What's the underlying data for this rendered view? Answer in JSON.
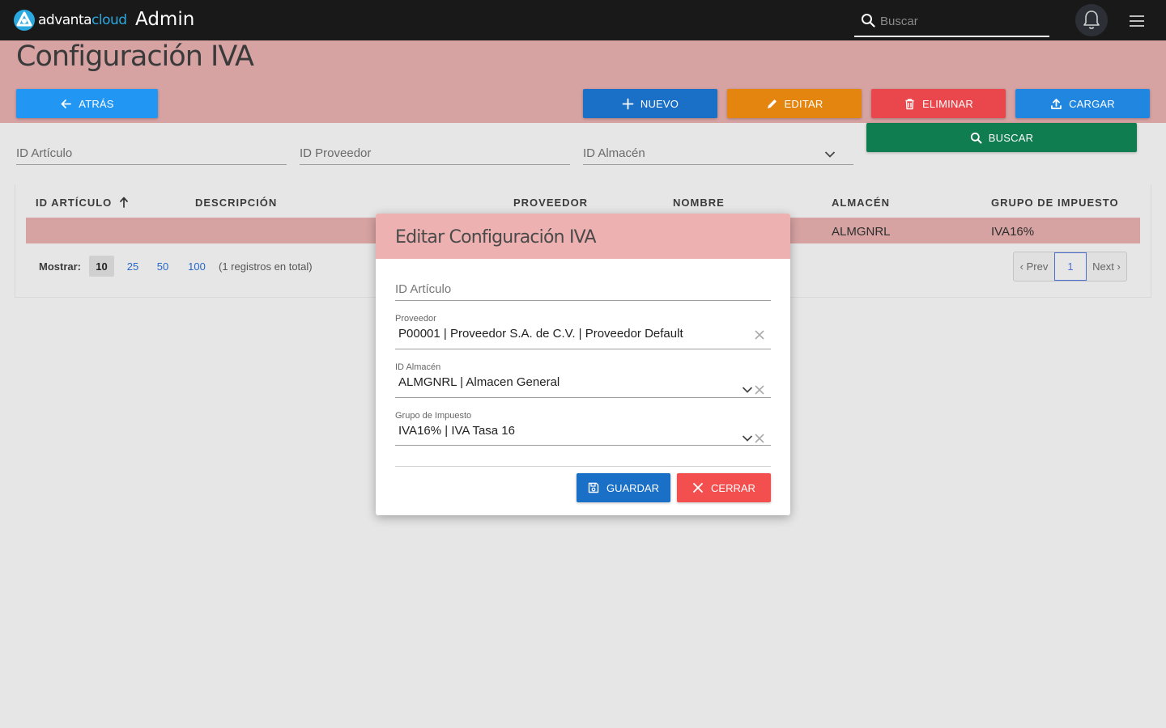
{
  "app": {
    "logo_part1": "advanta",
    "logo_part2": "cloud",
    "title": "Admin"
  },
  "topbar": {
    "search_placeholder": "Buscar",
    "icons": [
      "search-icon",
      "bell-icon",
      "menu-icon"
    ]
  },
  "page": {
    "title": "Configuración IVA"
  },
  "toolbar": {
    "back_label": "ATRÁS",
    "new_label": "NUEVO",
    "edit_label": "EDITAR",
    "delete_label": "ELIMINAR",
    "load_label": "CARGAR",
    "search_label": "BUSCAR"
  },
  "filters": {
    "articulo": "ID Artículo",
    "proveedor": "ID Proveedor",
    "almacen": "ID Almacén"
  },
  "table": {
    "columns": [
      "ID ARTÍCULO",
      "DESCRIPCIÓN",
      "PROVEEDOR",
      "NOMBRE",
      "ALMACÉN",
      "GRUPO DE IMPUESTO"
    ],
    "rows": [
      {
        "almacen": "ALMGNRL",
        "grupo": "IVA16%"
      }
    ]
  },
  "pagination": {
    "show_label": "Mostrar:",
    "sizes": [
      "10",
      "25",
      "50",
      "100"
    ],
    "selected_size": "10",
    "total_text": "(1 registros en total)",
    "prev": "‹ Prev",
    "current": "1",
    "next": "Next ›"
  },
  "modal": {
    "title": "Editar Configuración IVA",
    "articulo_placeholder": "ID Artículo",
    "proveedor_label": "Proveedor",
    "proveedor_value": "P00001 | Proveedor S.A. de C.V. | Proveedor Default",
    "almacen_label": "ID Almacén",
    "almacen_value": "ALMGNRL | Almacen General",
    "grupo_label": "Grupo de Impuesto",
    "grupo_value": "IVA16% | IVA Tasa 16",
    "save_label": "GUARDAR",
    "close_label": "CERRAR"
  },
  "colors": {
    "topbar": "#191919",
    "header_pink": "#d6a2a2",
    "modal_header": "#edb1b1",
    "primary_blue": "#1a6fc7",
    "light_blue": "#2196f3",
    "orange": "#e3850f",
    "red": "#e9474b",
    "green": "#0f7d4f",
    "logo_accent": "#2aa8e0"
  }
}
